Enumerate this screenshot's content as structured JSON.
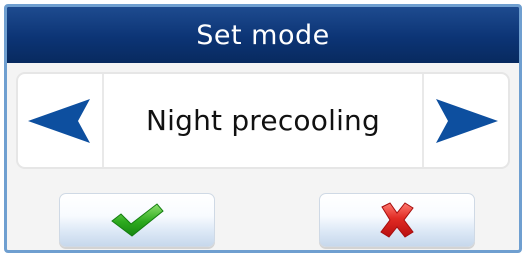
{
  "dialog": {
    "title": "Set mode",
    "mode_label": "Night precooling"
  },
  "icons": {
    "previous": "left-arrow-icon",
    "next": "right-arrow-icon",
    "confirm": "checkmark-icon",
    "cancel": "cross-icon"
  },
  "colors": {
    "title_bar": "#0c3475",
    "arrow": "#0d4f9f",
    "confirm": "#25a51a",
    "cancel": "#d91818"
  }
}
